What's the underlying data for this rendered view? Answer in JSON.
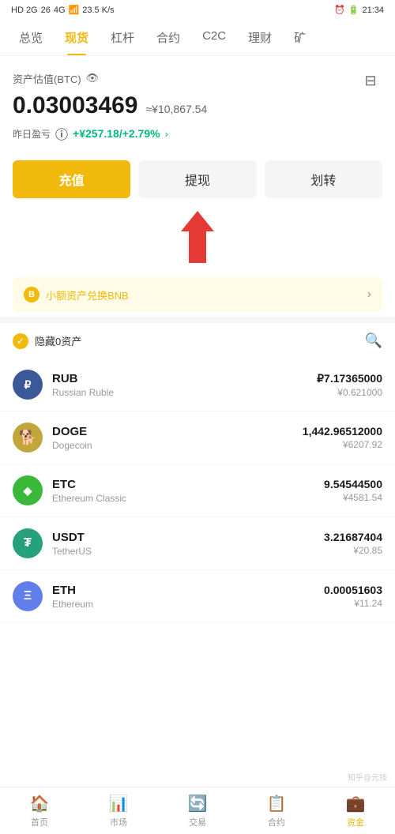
{
  "status": {
    "left": "HD 2G 26 4G",
    "signal": "WiFi",
    "speed": "23.5 K/s",
    "time": "21:34",
    "battery": "20"
  },
  "nav": {
    "tabs": [
      {
        "label": "总览",
        "active": false
      },
      {
        "label": "现货",
        "active": true
      },
      {
        "label": "杠杆",
        "active": false
      },
      {
        "label": "合约",
        "active": false
      },
      {
        "label": "C2C",
        "active": false
      },
      {
        "label": "理财",
        "active": false
      },
      {
        "label": "矿",
        "active": false
      }
    ]
  },
  "asset": {
    "label": "资产估值(BTC)",
    "btc_value": "0.03003469",
    "cny_approx": "≈¥10,867.54",
    "pnl_label": "昨日盈亏",
    "pnl_value": "+¥257.18/+2.79%",
    "pnl_arrow": "›"
  },
  "buttons": {
    "deposit": "充值",
    "withdraw": "提现",
    "transfer": "划转"
  },
  "bnb_banner": {
    "text": "小额资产兑换BNB",
    "icon": "B"
  },
  "filter": {
    "label": "隐藏0资产"
  },
  "cryptos": [
    {
      "symbol": "RUB",
      "name": "Russian Ruble",
      "amount": "₽7.17365000",
      "cny": "¥0.621000",
      "bg": "#3b5998",
      "text_color": "#fff",
      "initial": "₽"
    },
    {
      "symbol": "DOGE",
      "name": "Dogecoin",
      "amount": "1,442.96512000",
      "cny": "¥6207.92",
      "bg": "#c2a63c",
      "text_color": "#fff",
      "initial": "D"
    },
    {
      "symbol": "ETC",
      "name": "Ethereum Classic",
      "amount": "9.54544500",
      "cny": "¥4581.54",
      "bg": "#3ab83a",
      "text_color": "#fff",
      "initial": "◆"
    },
    {
      "symbol": "USDT",
      "name": "TetherUS",
      "amount": "3.21687404",
      "cny": "¥20.85",
      "bg": "#26a17b",
      "text_color": "#fff",
      "initial": "₮"
    },
    {
      "symbol": "ETH",
      "name": "Ethereum",
      "amount": "0.00051603",
      "cny": "¥11.24",
      "bg": "#627eea",
      "text_color": "#fff",
      "initial": "Ξ"
    }
  ],
  "bottom_nav": [
    {
      "label": "首页",
      "icon": "🏠",
      "active": false
    },
    {
      "label": "市场",
      "icon": "📊",
      "active": false
    },
    {
      "label": "交易",
      "icon": "🔄",
      "active": false
    },
    {
      "label": "合约",
      "icon": "📋",
      "active": false
    },
    {
      "label": "资金",
      "icon": "💼",
      "active": true
    }
  ]
}
